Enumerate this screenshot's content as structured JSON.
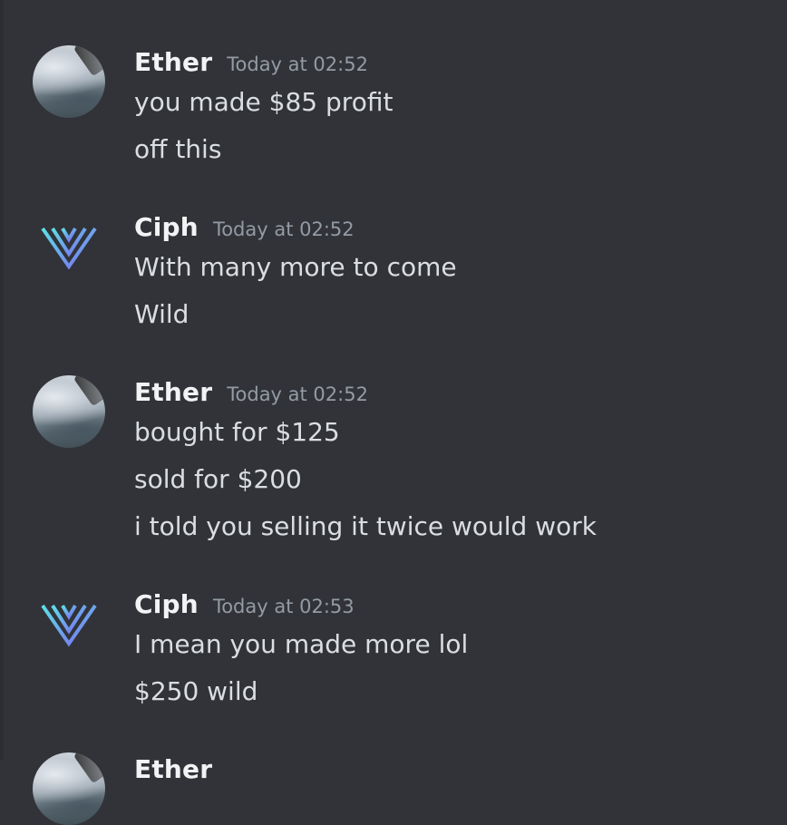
{
  "messages": [
    {
      "author": "Ether",
      "avatar": "photo-avatar",
      "timestamp": "Today at 02:52",
      "lines": [
        "you made $85 profit",
        "off this"
      ]
    },
    {
      "author": "Ciph",
      "avatar": "v-logo-icon",
      "timestamp": "Today at 02:52",
      "lines": [
        "With many more to come",
        "Wild"
      ]
    },
    {
      "author": "Ether",
      "avatar": "photo-avatar",
      "timestamp": "Today at 02:52",
      "lines": [
        "bought for $125",
        "sold for $200",
        "i told you selling it twice would work"
      ]
    },
    {
      "author": "Ciph",
      "avatar": "v-logo-icon",
      "timestamp": "Today at 02:53",
      "lines": [
        "I mean you made more lol",
        "$250 wild"
      ]
    },
    {
      "author": "Ether",
      "avatar": "photo-avatar",
      "timestamp": "",
      "lines": []
    }
  ],
  "colors": {
    "background": "#313338",
    "username": "#f2f3f5",
    "timestamp": "#949ba4",
    "text": "#dbdee1",
    "logo_gradient_start": "#5ee0e8",
    "logo_gradient_end": "#7b6cf0"
  }
}
